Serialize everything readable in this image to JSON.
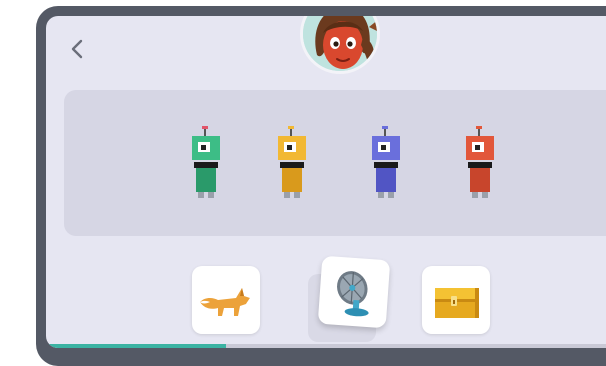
{
  "colors": {
    "frame": "#545965",
    "screen": "#e6e6f2",
    "stage": "#d6d6e4",
    "progress": "#3bb3a3"
  },
  "header": {
    "back_icon": "chevron-left-icon",
    "avatar_icon": "girl-avatar-icon"
  },
  "robots": [
    {
      "name": "green-robot",
      "color": "#3dbd86",
      "dark": "#2a9a6a",
      "antenna": "#e2556a"
    },
    {
      "name": "yellow-robot",
      "color": "#f2b833",
      "dark": "#d99a1c",
      "antenna": "#f2b833"
    },
    {
      "name": "purple-robot",
      "color": "#6a6fdc",
      "dark": "#5155c4",
      "antenna": "#6a6fdc"
    },
    {
      "name": "red-robot",
      "color": "#e2573a",
      "dark": "#c8452c",
      "antenna": "#e2573a"
    }
  ],
  "cards": [
    {
      "name": "fox-card",
      "icon": "fox-icon"
    },
    {
      "name": "fan-card",
      "icon": "fan-icon"
    },
    {
      "name": "chest-card",
      "icon": "treasure-chest-icon"
    }
  ],
  "progress": {
    "fraction": 0.31
  }
}
